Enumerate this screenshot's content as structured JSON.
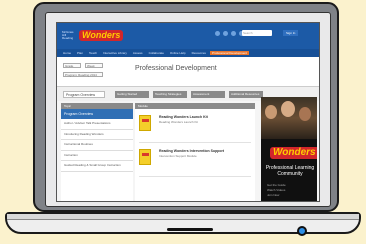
{
  "header": {
    "logo_small": "McGraw-Hill Reading",
    "logo_word": "Wonders",
    "search_placeholder": "Search",
    "signin": "Sign In"
  },
  "nav": {
    "items": [
      "Home",
      "Plan",
      "Teach",
      "Interactive Library",
      "Assess",
      "Collaborate",
      "Online Help",
      "Resources",
      "Professional Development"
    ],
    "active_index": 8
  },
  "subbar": {
    "grade_select": "Grade",
    "unit_select": "Week",
    "program_select": "Program: Reading 2014",
    "title": "Professional Development"
  },
  "tabs_row": {
    "label": "Program Overview",
    "tabs": [
      "Getting Started",
      "Teaching Strategies",
      "Assessment",
      "Additional Resources"
    ]
  },
  "sidebar": {
    "header": "Topic",
    "active": "Program Overview",
    "items": [
      "Author / Advisor Talk Presentations",
      "Introducing Reading Wonders",
      "Instructional Routines",
      "Instruction",
      "Guided Reading & Small Group Instruction"
    ]
  },
  "main": {
    "header": "Module",
    "entries": [
      {
        "title": "Reading Wonders Launch Kit",
        "subtitle": "Reading Wonders Launch Kit"
      },
      {
        "title": "Reading Wonders Intervention Support",
        "subtitle": "Intervention Support Module"
      }
    ]
  },
  "promo": {
    "logo": "Wonders",
    "text": "Professional Learning Community",
    "links": [
      "Get the Guide",
      "Watch Videos",
      "Join Now"
    ]
  },
  "colors": {
    "header_blue": "#1c5aa6",
    "nav_active": "#e9742b",
    "sidebar_active": "#2f6fb5",
    "background": "#fbf2cd",
    "led_blue": "#2d8fe6"
  }
}
